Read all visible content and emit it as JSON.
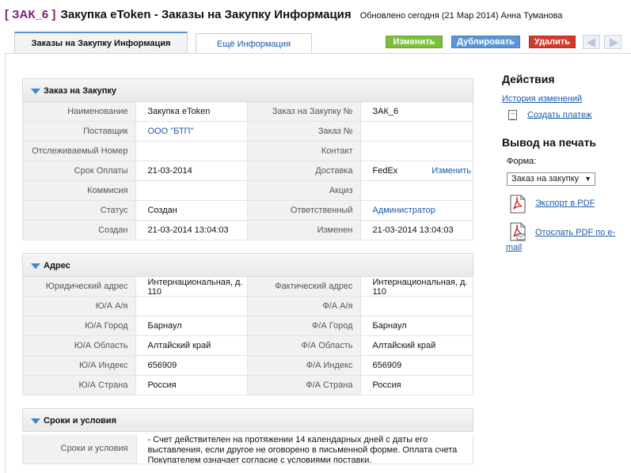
{
  "header": {
    "record_id": "[ ЗАК_6 ]",
    "title": "Закупка eToken - Заказы на Закупку Информация",
    "updated": "Обновлено сегодня (21 Мар 2014) Анна Туманова"
  },
  "tabs": [
    {
      "label": "Заказы на Закупку Информация"
    },
    {
      "label": "Ещё Информация"
    }
  ],
  "toolbar": {
    "edit_label": "Изменить",
    "duplicate_label": "Дублировать",
    "delete_label": "Удалить"
  },
  "colors": {
    "record_id": "#7a1f6f",
    "edit": "#7cbf3a",
    "duplicate": "#5a95d6",
    "delete": "#d23a2a",
    "link": "#1a5aa6"
  },
  "icons": {
    "prev": "arrow-left-icon",
    "next": "arrow-right-icon",
    "caret": "caret-down-icon",
    "doc": "document-icon",
    "pdf": "pdf-icon"
  },
  "order": {
    "title": "Заказ на Закупку",
    "rows": [
      {
        "l1": "Наименование",
        "v1": "Закупка eToken",
        "l2": "Заказ на Закупку №",
        "v2": "ЗАК_6"
      },
      {
        "l1": "Поставщик",
        "v1": "ООО \"БТП\"",
        "l2": "Заказ №",
        "v2": ""
      },
      {
        "l1": "Отслеживаемый Номер",
        "v1": "",
        "l2": "Контакт",
        "v2": ""
      },
      {
        "l1": "Срок Оплаты",
        "v1": "21-03-2014",
        "l2": "Доставка",
        "v2": "FedEx",
        "v2_edit": "Изменить"
      },
      {
        "l1": "Коммисия",
        "v1": "",
        "l2": "Акциз",
        "v2": ""
      },
      {
        "l1": "Статус",
        "v1": "Создан",
        "l2": "Ответственный",
        "v2": "Администратор"
      },
      {
        "l1": "Создан",
        "v1": "21-03-2014 13:04:03",
        "l2": "Изменен",
        "v2": "21-03-2014 13:04:03"
      }
    ]
  },
  "address": {
    "title": "Адрес",
    "rows": [
      {
        "l1": "Юридический адрес",
        "v1": "Интернациональная, д. 110",
        "l2": "Фактический адрес",
        "v2": "Интернациональная, д. 110"
      },
      {
        "l1": "Ю/А А/я",
        "v1": "",
        "l2": "Ф/А А/я",
        "v2": ""
      },
      {
        "l1": "Ю/А Город",
        "v1": "Барнаул",
        "l2": "Ф/А Город",
        "v2": "Барнаул"
      },
      {
        "l1": "Ю/А Область",
        "v1": "Алтайский край",
        "l2": "Ф/А Область",
        "v2": "Алтайский край"
      },
      {
        "l1": "Ю/А Индекс",
        "v1": "656909",
        "l2": "Ф/А Индекс",
        "v2": "656909"
      },
      {
        "l1": "Ю/А Страна",
        "v1": "Россия",
        "l2": "Ф/А Страна",
        "v2": "Россия"
      }
    ]
  },
  "terms": {
    "title": "Сроки и условия",
    "label": "Сроки и условия",
    "value": "- Счет действителен на протяжении 14 календарных дней с даты его выставления, если другое не оговорено в письменной форме. Оплата счета Покупателем означает согласие с условиями поставки."
  },
  "sidebar": {
    "actions_title": "Действия",
    "history_link": "История изменений",
    "create_payment_link": "Создать платеж",
    "print_title": "Вывод на печать",
    "form_label": "Форма:",
    "form_selected": "Заказ на закупку",
    "export_pdf_link": "Экспорт в PDF",
    "send_pdf_link": "Отослать PDF по e-mail"
  }
}
